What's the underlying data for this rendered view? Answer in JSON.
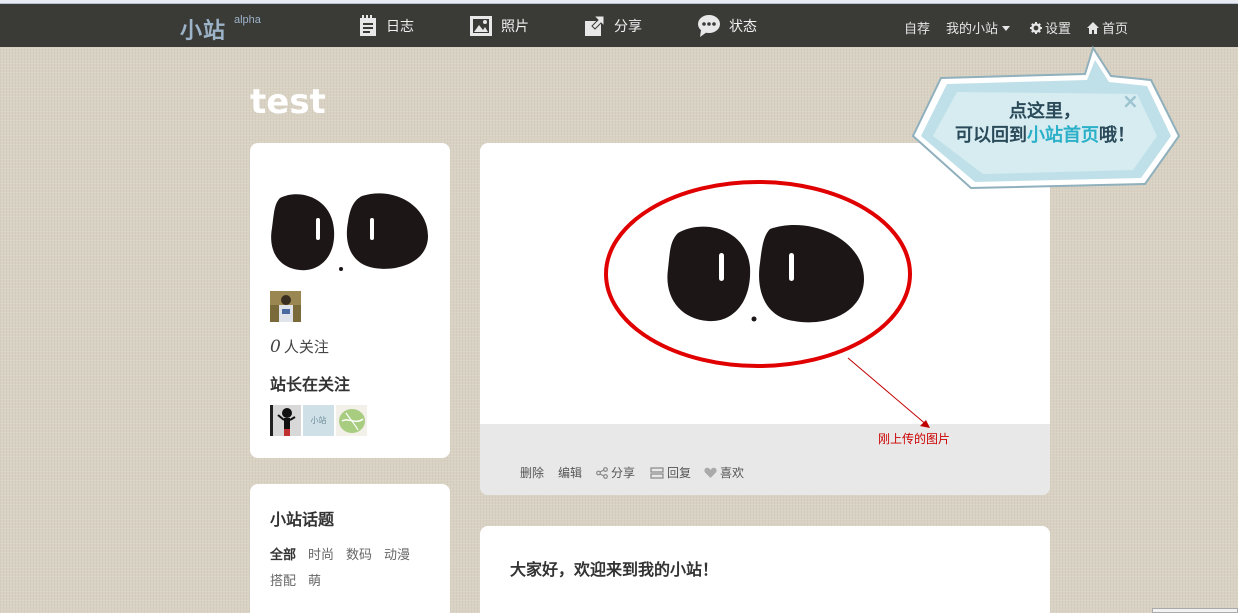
{
  "header": {
    "logo": "小站",
    "logo_sup": "alpha",
    "nav": [
      {
        "label": "日志",
        "icon": "notebook-icon"
      },
      {
        "label": "照片",
        "icon": "photo-icon"
      },
      {
        "label": "分享",
        "icon": "share-icon"
      },
      {
        "label": "状态",
        "icon": "chat-bubble-icon"
      }
    ],
    "right": {
      "self": "自荐",
      "my_sites": "我的小站",
      "settings": "设置",
      "home": "首页"
    }
  },
  "site": {
    "title": "test"
  },
  "sidebar": {
    "follow_num": "0",
    "follow_label": "人关注",
    "owner_following": "站长在关注",
    "thumb2_label": "小站",
    "topics_title": "小站话题",
    "tags": [
      "全部",
      "时尚",
      "数码",
      "动漫",
      "搭配",
      "萌"
    ]
  },
  "post": {
    "actions": [
      "删除",
      "编辑",
      "分享",
      "回复",
      "喜欢"
    ],
    "annotation": "刚上传的图片"
  },
  "post2": {
    "text": "大家好，欢迎来到我的小站！"
  },
  "tooltip": {
    "line1": "点这里，",
    "line2_prefix": "可以回到",
    "line2_highlight": "小站首页",
    "line2_suffix": "哦！",
    "close": "×"
  },
  "colors": {
    "topbar": "#3a3a37",
    "background": "#d9d2c4",
    "logo": "#9cb3c8",
    "annotation": "#cc0000",
    "bubble": "#bfe0e8"
  }
}
